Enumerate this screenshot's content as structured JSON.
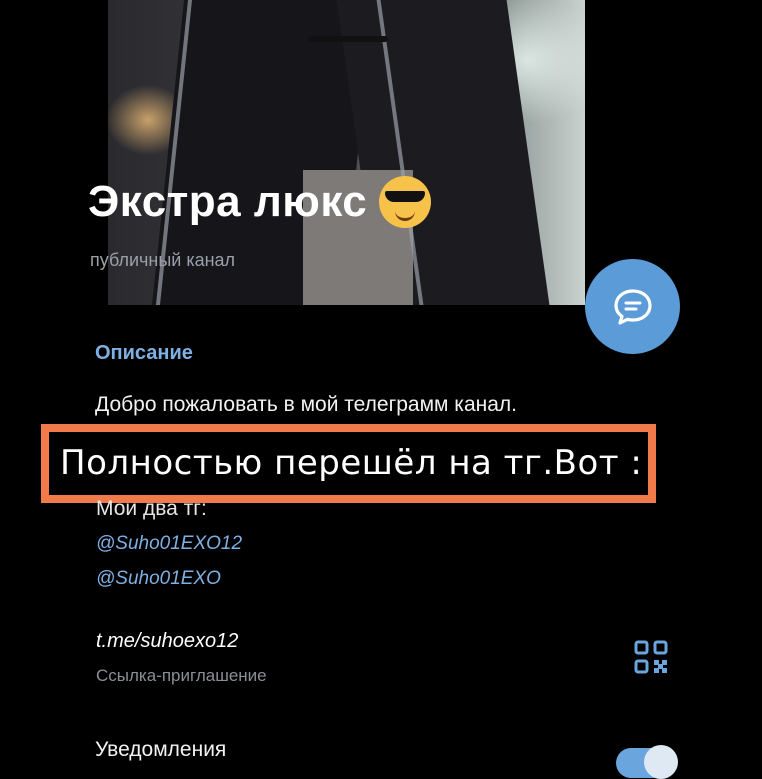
{
  "channel": {
    "title": "Экстра люкс",
    "type_label": "публичный канал"
  },
  "icons": {
    "emoji": "sunglasses-face-emoji",
    "fab": "chat-bubble-icon",
    "qr": "qr-code-icon"
  },
  "colors": {
    "accent": "#5a9bd8",
    "link": "#7fb0e3",
    "overlay_border": "#f07a4a",
    "background": "#000000"
  },
  "description": {
    "label": "Описание",
    "text": "Добро пожаловать в мой телеграмм канал.",
    "overlay_text": "Полностью перешёл на тг.Вот :",
    "more_text": "Мои два тг:",
    "mentions": [
      "@Suho01EXO12",
      "@Suho01EXO"
    ]
  },
  "invite": {
    "link": "t.me/suhoexo12",
    "label": "Ссылка-приглашение"
  },
  "notifications": {
    "label": "Уведомления",
    "enabled": true
  }
}
